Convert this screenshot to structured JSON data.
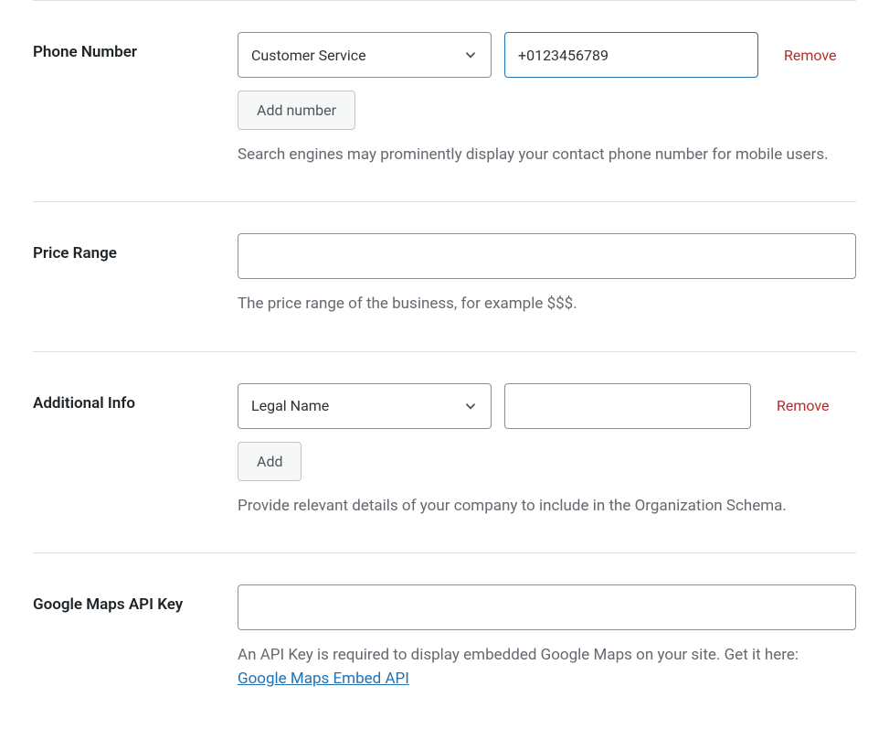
{
  "phone": {
    "label": "Phone Number",
    "type_selected": "Customer Service",
    "value": "+0123456789",
    "remove_label": "Remove",
    "add_button": "Add number",
    "help": "Search engines may prominently display your contact phone number for mobile users."
  },
  "price_range": {
    "label": "Price Range",
    "value": "",
    "help": "The price range of the business, for example $$$."
  },
  "additional_info": {
    "label": "Additional Info",
    "type_selected": "Legal Name",
    "value": "",
    "remove_label": "Remove",
    "add_button": "Add",
    "help": "Provide relevant details of your company to include in the Organization Schema."
  },
  "google_maps": {
    "label": "Google Maps API Key",
    "value": "",
    "help_prefix": "An API Key is required to display embedded Google Maps on your site. Get it here: ",
    "link_label": "Google Maps Embed API"
  }
}
